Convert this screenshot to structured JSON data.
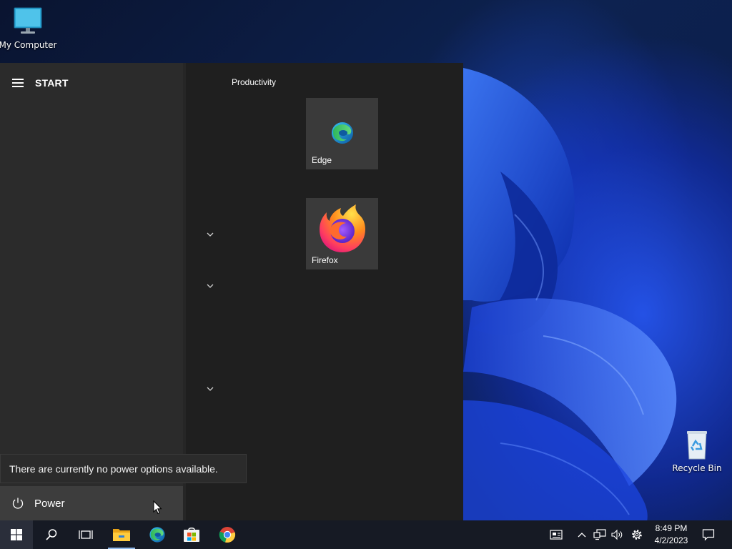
{
  "desktop": {
    "icons": [
      {
        "label": "My Computer",
        "icon": "monitor-icon"
      },
      {
        "label": "Recycle Bin",
        "icon": "recycle-bin-icon"
      }
    ]
  },
  "start_menu": {
    "title": "START",
    "group_title": "Productivity",
    "tiles": [
      {
        "label": "Edge",
        "icon": "edge-icon"
      },
      {
        "label": "Firefox",
        "icon": "firefox-icon"
      }
    ],
    "power_tooltip": "There are currently no power options available.",
    "power_label": "Power"
  },
  "taskbar": {
    "buttons": [
      "start-button",
      "search-button",
      "task-view-button",
      "file-explorer-button",
      "edge-button",
      "store-button",
      "chrome-button"
    ],
    "tray": [
      "news-icon",
      "chevron-up-icon",
      "network-icon",
      "volume-icon",
      "settings-icon"
    ],
    "clock": {
      "time": "8:49 PM",
      "date": "4/2/2023"
    }
  },
  "colors": {
    "start_bg": "#1f1f1f",
    "start_left_bg": "#2b2b2b",
    "tile_bg": "#3a3a3a",
    "taskbar_bg": "#161a24"
  }
}
